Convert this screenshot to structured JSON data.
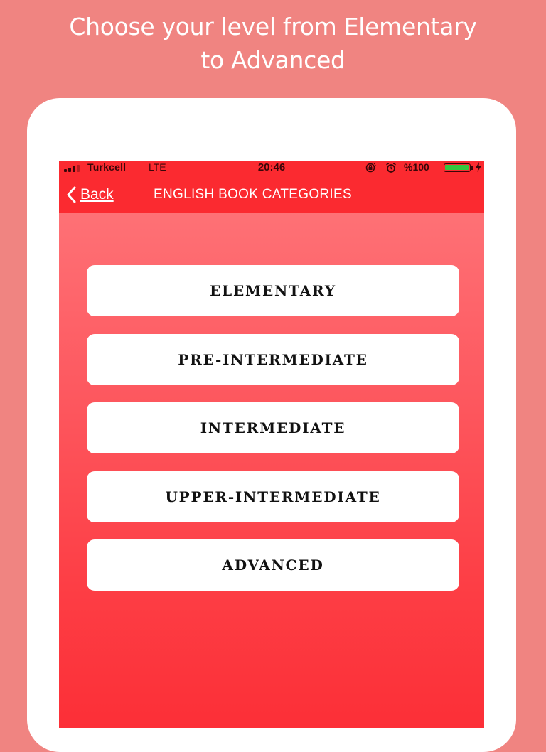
{
  "promo": {
    "headline_line1": "Choose your level from Elementary",
    "headline_line2": "to Advanced",
    "background_color": "#f08481"
  },
  "status_bar": {
    "carrier": "Turkcell",
    "network": "LTE",
    "time": "20:46",
    "battery_text": "%100",
    "battery_level": 1.0,
    "icons": [
      "signal-icon",
      "screen-lock-icon",
      "alarm-icon",
      "battery-icon",
      "charging-icon"
    ]
  },
  "nav": {
    "back_label": "Back",
    "title": "ENGLISH BOOK CATEGORIES",
    "bar_color": "#fb2a30"
  },
  "levels": [
    {
      "label": "ELEMENTARY"
    },
    {
      "label": "PRE-INTERMEDIATE"
    },
    {
      "label": "INTERMEDIATE"
    },
    {
      "label": "UPPER-INTERMEDIATE"
    },
    {
      "label": "ADVANCED"
    }
  ]
}
